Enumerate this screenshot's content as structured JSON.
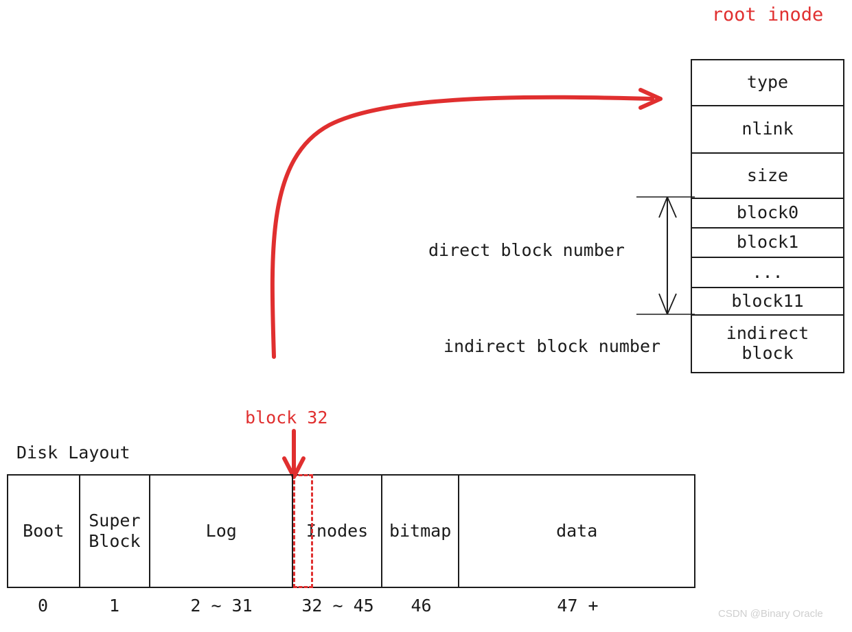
{
  "inode": {
    "title": "root inode",
    "fields": [
      {
        "label": "type"
      },
      {
        "label": "nlink"
      },
      {
        "label": "size"
      },
      {
        "label": "block0"
      },
      {
        "label": "block1"
      },
      {
        "label": "..."
      },
      {
        "label": "block11"
      },
      {
        "label_line1": "indirect",
        "label_line2": "block"
      }
    ]
  },
  "annotations": {
    "direct_block_number": "direct block number",
    "indirect_block_number": "indirect block number",
    "block32": "block 32"
  },
  "disk": {
    "title": "Disk Layout",
    "cells": [
      {
        "label": "Boot"
      },
      {
        "label_line1": "Super",
        "label_line2": "Block"
      },
      {
        "label": "Log"
      },
      {
        "label": "Inodes"
      },
      {
        "label": "bitmap"
      },
      {
        "label": "data"
      }
    ],
    "ranges": [
      "0",
      "1",
      "2 ~ 31",
      "32 ~ 45",
      "46",
      "47 +"
    ]
  },
  "watermark": "CSDN @Binary Oracle",
  "colors": {
    "accent_red": "#e02f2f",
    "ink": "#1b1b1b",
    "watermark": "#cfcfcf"
  }
}
